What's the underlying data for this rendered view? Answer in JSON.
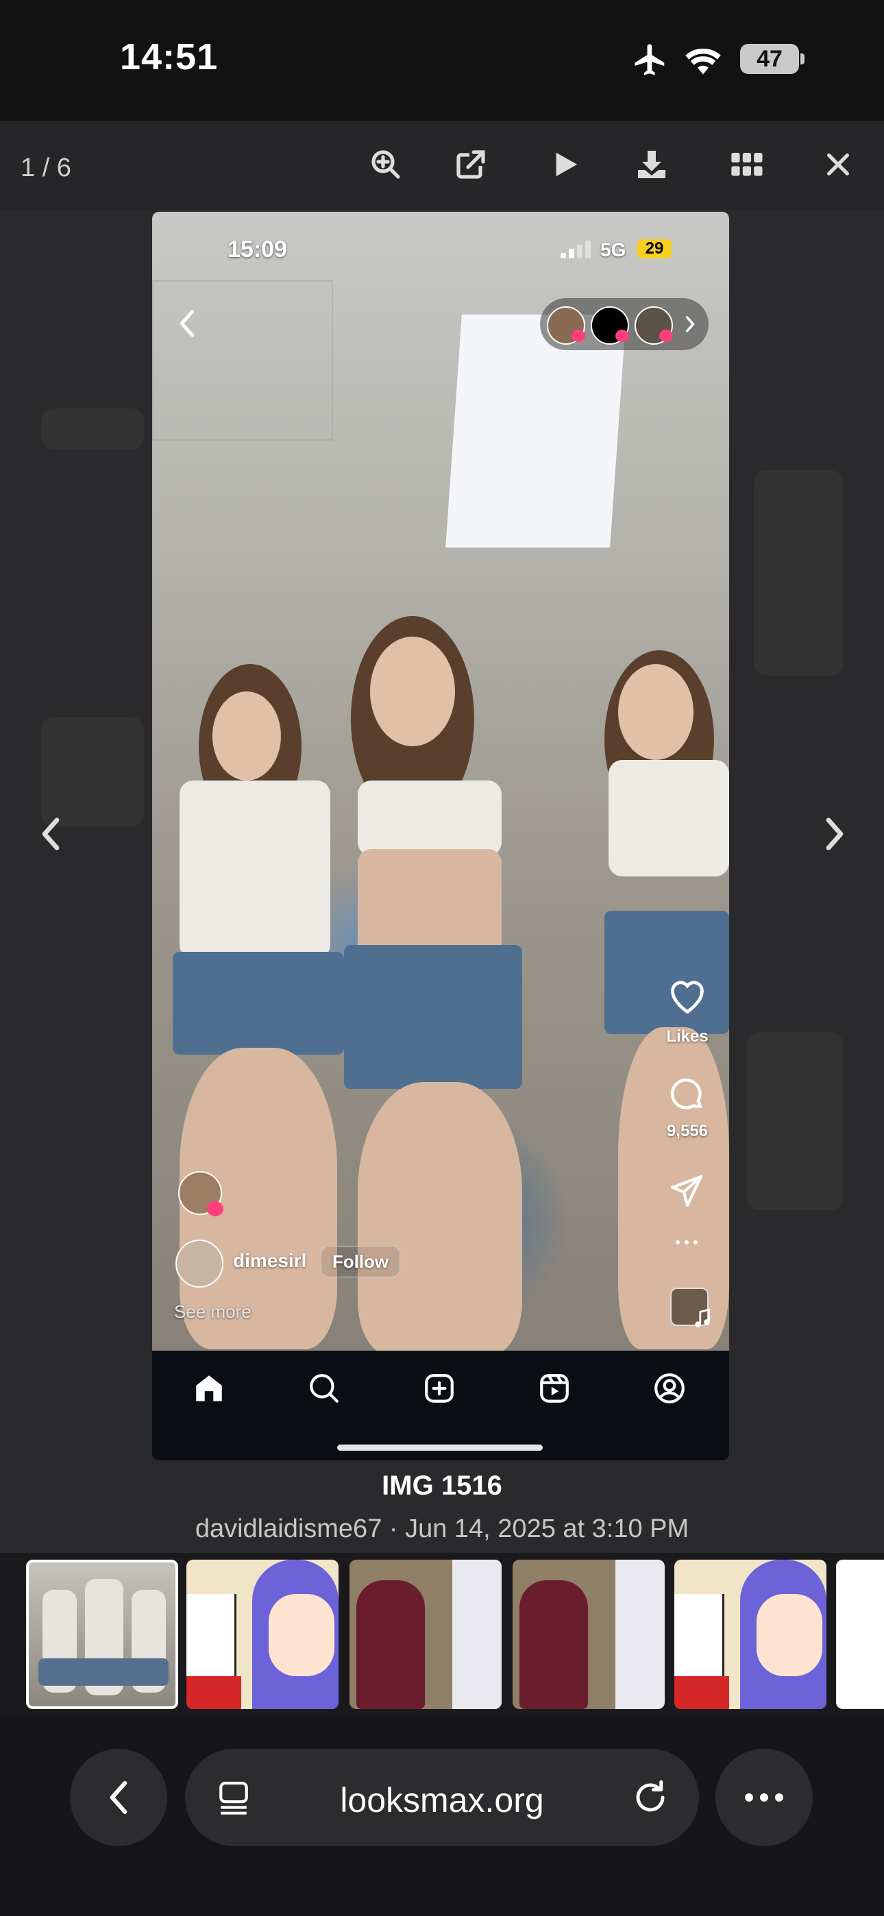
{
  "status_bar": {
    "time": "14:51",
    "battery": "47"
  },
  "viewer": {
    "page_counter": "1 / 6",
    "tools": [
      "zoom-in-icon",
      "open-external-icon",
      "play-icon",
      "download-icon",
      "grid-icon",
      "close-icon"
    ]
  },
  "post": {
    "status_time": "15:09",
    "network": "5G",
    "battery": "29",
    "likes_label": "Likes",
    "comments_count": "9,556",
    "username": "dimesirl",
    "follow_label": "Follow",
    "see_more": "See more"
  },
  "caption": {
    "title": "IMG 1516",
    "meta": "davidlaidisme67 · Jun 14, 2025 at 3:10 PM"
  },
  "browser": {
    "url": "looksmax.org"
  },
  "colors": {
    "accent_pink": "#ff3f7a",
    "battery_yellow": "#f5d020",
    "background": "#1c1c1e"
  }
}
